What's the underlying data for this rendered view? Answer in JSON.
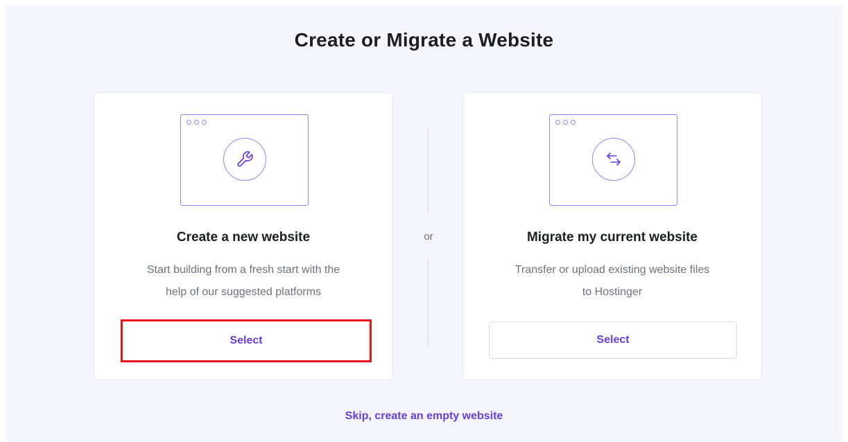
{
  "page": {
    "title": "Create or Migrate a Website"
  },
  "create_card": {
    "title": "Create a new website",
    "description_line1": "Start building from a fresh start with the",
    "description_line2": "help of our suggested platforms",
    "button_label": "Select",
    "icon": "wrench-icon"
  },
  "migrate_card": {
    "title": "Migrate my current website",
    "description_line1": "Transfer or upload existing website files",
    "description_line2": "to Hostinger",
    "button_label": "Select",
    "icon": "arrows-transfer-icon"
  },
  "divider": {
    "label": "or"
  },
  "skip_link": {
    "label": "Skip, create an empty website"
  },
  "colors": {
    "accent": "#673de6",
    "illustration": "#8c85ff",
    "highlight": "#e8131b",
    "background": "#f4f5ff"
  }
}
